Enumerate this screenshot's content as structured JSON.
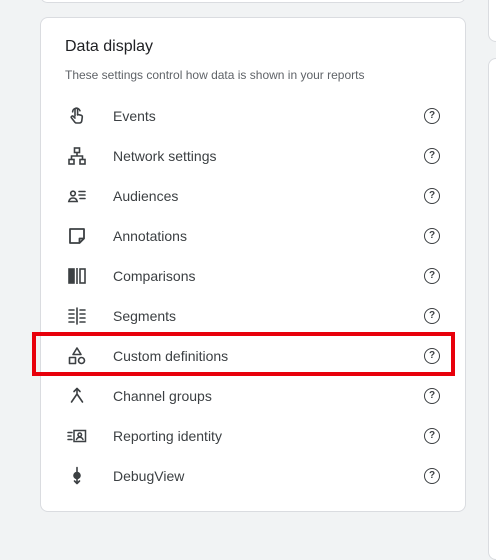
{
  "section": {
    "title": "Data display",
    "description": "These settings control how data is shown in your reports"
  },
  "items": [
    {
      "label": "Events",
      "icon": "touch-icon"
    },
    {
      "label": "Network settings",
      "icon": "network-icon"
    },
    {
      "label": "Audiences",
      "icon": "audiences-icon"
    },
    {
      "label": "Annotations",
      "icon": "annotation-icon"
    },
    {
      "label": "Comparisons",
      "icon": "comparison-icon"
    },
    {
      "label": "Segments",
      "icon": "segments-icon"
    },
    {
      "label": "Custom definitions",
      "icon": "shapes-icon"
    },
    {
      "label": "Channel groups",
      "icon": "merge-icon"
    },
    {
      "label": "Reporting identity",
      "icon": "identity-icon"
    },
    {
      "label": "DebugView",
      "icon": "debug-icon"
    }
  ],
  "help_glyph": "?",
  "highlighted_item": "Custom definitions",
  "colors": {
    "highlight": "#e8000b",
    "text": "#3c4043",
    "muted": "#5f6368",
    "border": "#dadce0",
    "background": "#f1f3f4"
  }
}
